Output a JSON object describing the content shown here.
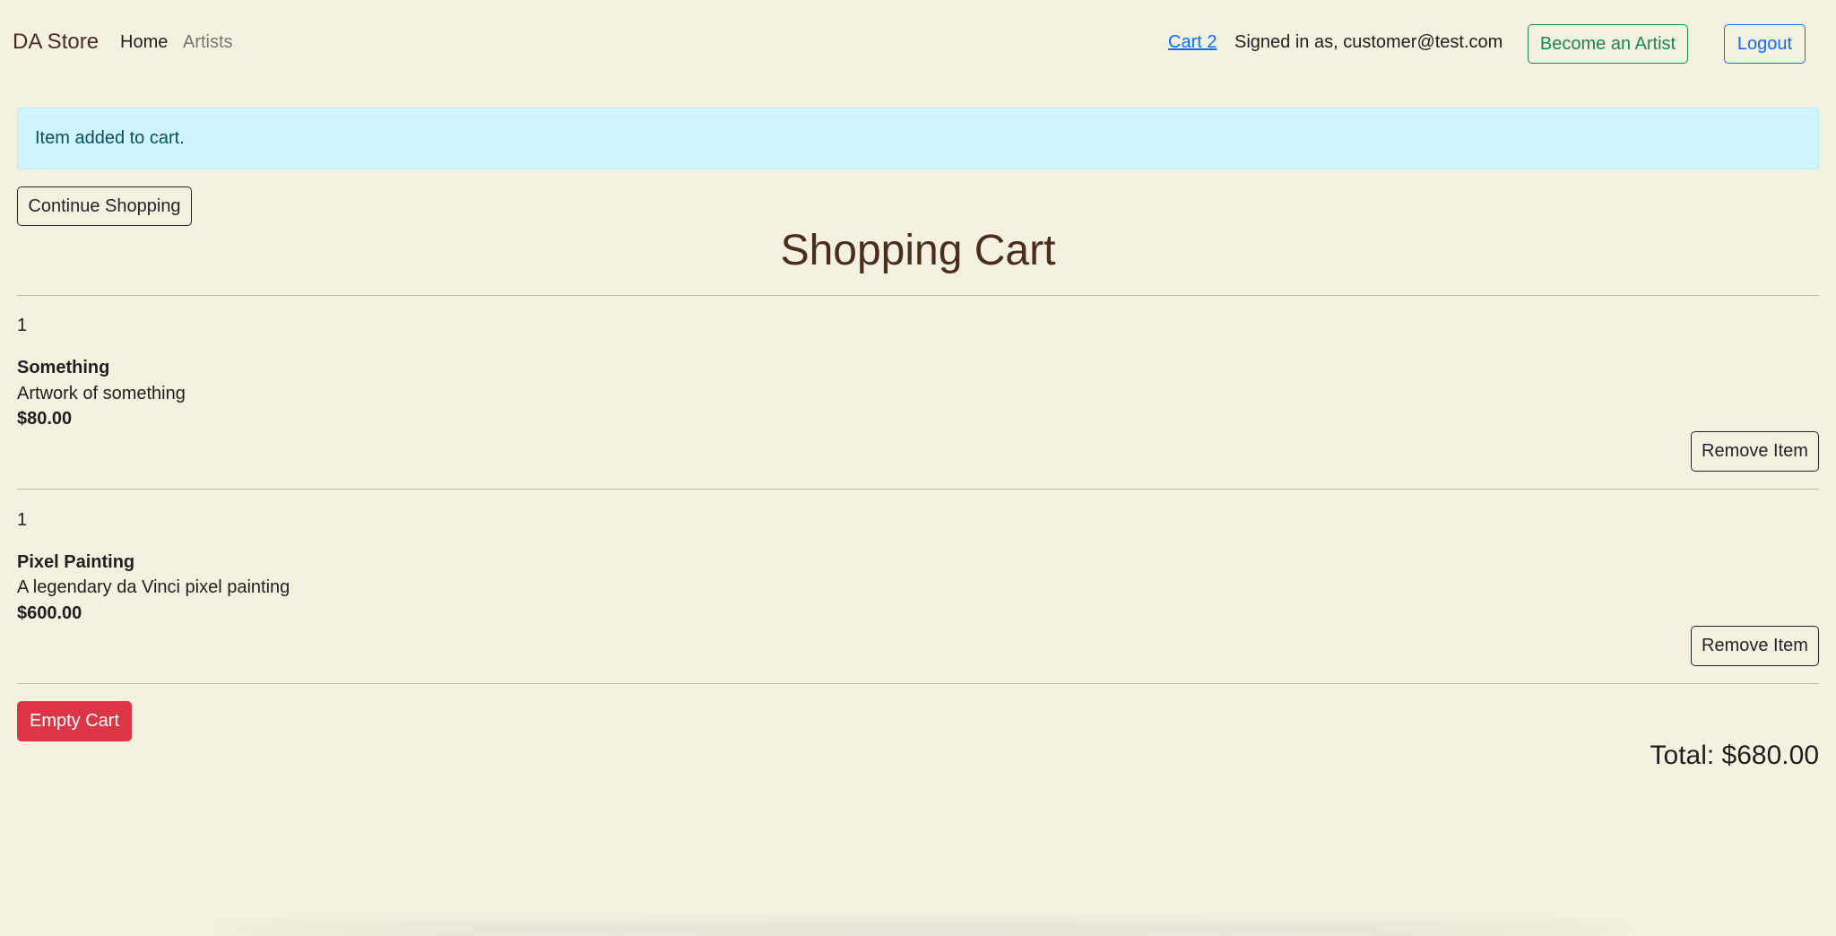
{
  "nav": {
    "brand": "DA Store",
    "home": "Home",
    "artists": "Artists",
    "cart": "Cart 2",
    "signed_in": "Signed in as, customer@test.com",
    "become_artist": "Become an Artist",
    "logout": "Logout"
  },
  "alert": {
    "message": "Item added to cart."
  },
  "actions": {
    "continue_shopping": "Continue Shopping",
    "empty_cart": "Empty Cart"
  },
  "cart": {
    "title": "Shopping Cart",
    "items": [
      {
        "quantity": "1",
        "name": "Something",
        "description": "Artwork of something",
        "price": "$80.00",
        "remove_label": "Remove Item"
      },
      {
        "quantity": "1",
        "name": "Pixel Painting",
        "description": "A legendary da Vinci pixel painting",
        "price": "$600.00",
        "remove_label": "Remove Item"
      }
    ],
    "total": "Total: $680.00"
  },
  "colors": {
    "background": "#f5f1e1",
    "brand": "#4a2e1d",
    "primary": "#0d6efd",
    "success": "#198754",
    "danger": "#dc3545",
    "info_bg": "#cff4fc"
  }
}
